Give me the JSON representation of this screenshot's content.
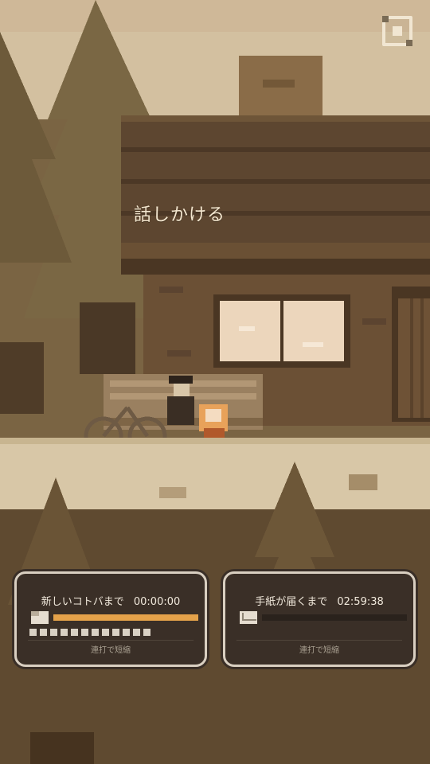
{
  "scene": {
    "speech_label": "話しかける"
  },
  "timers": [
    {
      "label": "新しいコトバまで",
      "time": "00:00:00",
      "icon": "paper-icon",
      "progress": 1.0,
      "dots": 12,
      "hint": "連打で短縮"
    },
    {
      "label": "手紙が届くまで",
      "time": "02:59:38",
      "icon": "envelope-icon",
      "progress": 0.0,
      "hint": "連打で短縮"
    }
  ],
  "colors": {
    "accent": "#e4a24a",
    "panel_bg": "#3a2f27",
    "panel_border": "#d9cfc1"
  }
}
